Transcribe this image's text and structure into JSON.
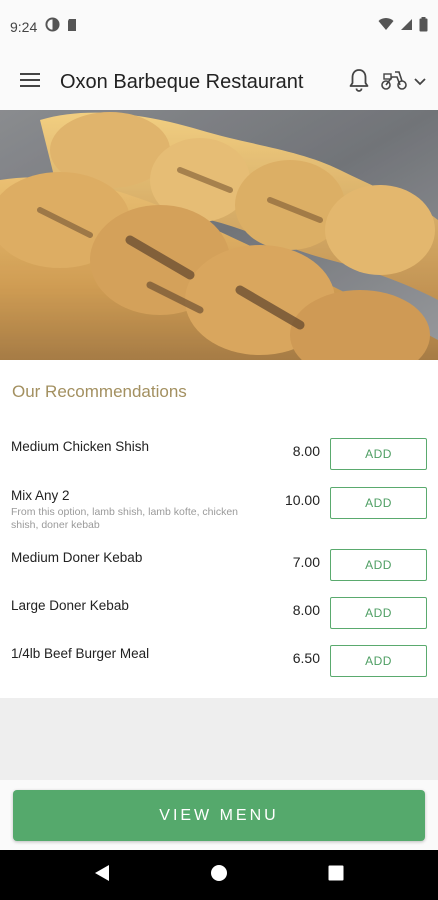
{
  "status_bar": {
    "time": "9:24"
  },
  "app_bar": {
    "title": "Oxon Barbeque Restaurant"
  },
  "recommendations": {
    "heading": "Our Recommendations",
    "items": [
      {
        "name": "Medium Chicken Shish",
        "description": "",
        "price": "8.00",
        "button": "ADD"
      },
      {
        "name": "Mix Any 2",
        "description": "From this option, lamb shish, lamb kofte, chicken shish, doner kebab",
        "price": "10.00",
        "button": "ADD"
      },
      {
        "name": "Medium Doner Kebab",
        "description": "",
        "price": "7.00",
        "button": "ADD"
      },
      {
        "name": "Large Doner Kebab",
        "description": "",
        "price": "8.00",
        "button": "ADD"
      },
      {
        "name": "1/4lb Beef Burger Meal",
        "description": "",
        "price": "6.50",
        "button": "ADD"
      }
    ]
  },
  "footer": {
    "view_menu_label": "VIEW MENU"
  },
  "colors": {
    "accent_green": "#55a96c",
    "heading_gold": "#a39060"
  },
  "icons": {
    "menu": "hamburger-icon",
    "notifications": "bell-icon",
    "delivery": "scooter-icon",
    "dropdown": "chevron-down-icon"
  }
}
